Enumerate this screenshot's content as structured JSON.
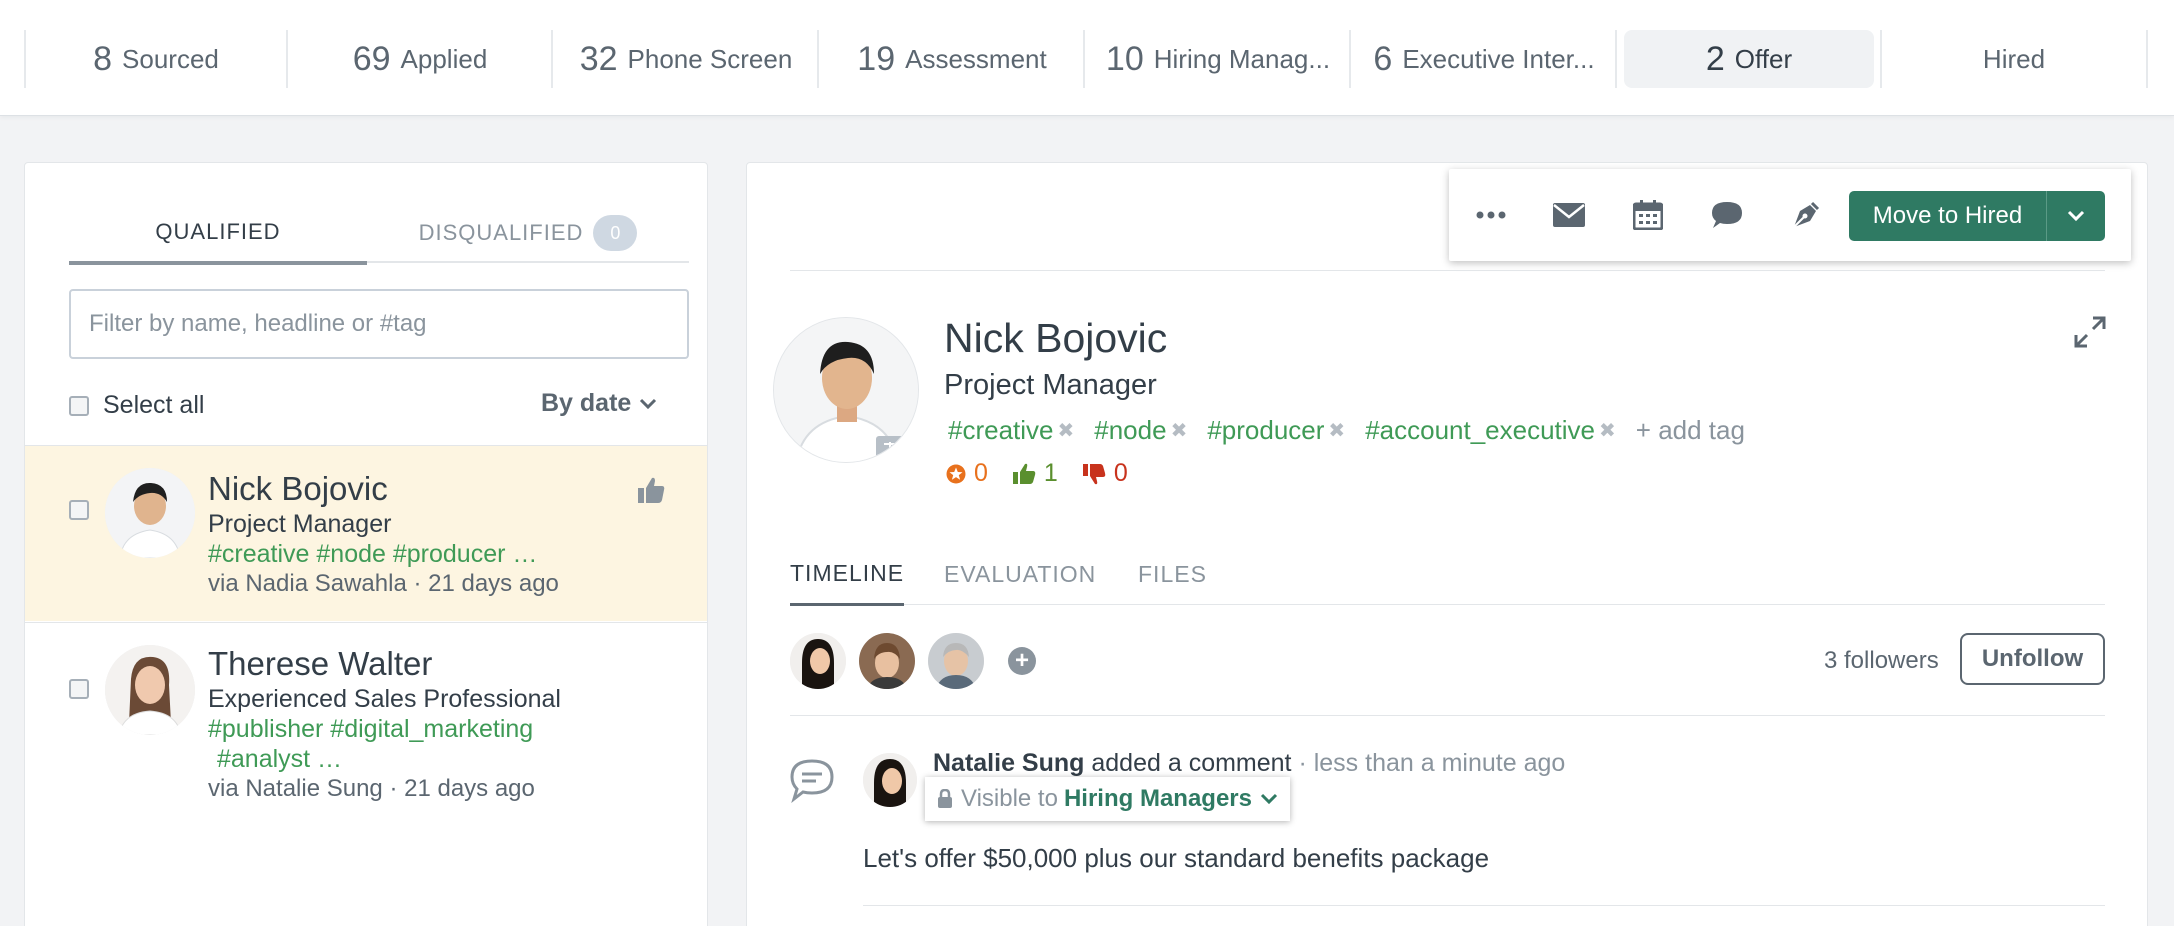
{
  "stages": [
    {
      "count": "8",
      "label": "Sourced"
    },
    {
      "count": "69",
      "label": "Applied"
    },
    {
      "count": "32",
      "label": "Phone Screen"
    },
    {
      "count": "19",
      "label": "Assessment"
    },
    {
      "count": "10",
      "label": "Hiring Manag..."
    },
    {
      "count": "6",
      "label": "Executive Inter..."
    },
    {
      "count": "2",
      "label": "Offer"
    },
    {
      "count": "",
      "label": "Hired"
    }
  ],
  "left": {
    "tab_qualified": "QUALIFIED",
    "tab_disqualified": "DISQUALIFIED",
    "disqualified_count": "0",
    "filter_placeholder": "Filter by name, headline or #tag",
    "select_all": "Select all",
    "sort_label": "By date",
    "candidates": [
      {
        "name": "Nick Bojovic",
        "headline": "Project Manager",
        "tags": "#creative #node #producer …",
        "via": "via Nadia Sawahla · 21 days ago"
      },
      {
        "name": "Therese Walter",
        "headline": "Experienced Sales Professional",
        "tags_line1": "#publisher #digital_marketing",
        "tags_line2": "#analyst …",
        "via": "via Natalie Sung · 21 days ago"
      }
    ]
  },
  "toolbar": {
    "more_icon": "more-icon",
    "email_icon": "email-icon",
    "calendar_icon": "calendar-icon",
    "chat_icon": "chat-icon",
    "sign_icon": "signature-icon",
    "move_label": "Move to Hired"
  },
  "profile": {
    "name": "Nick Bojovic",
    "headline": "Project Manager",
    "tags": [
      "#creative",
      "#node",
      "#producer",
      "#account_executive"
    ],
    "add_tag": "+ add tag",
    "score_star": "0",
    "score_up": "1",
    "score_down": "0"
  },
  "detail_tabs": [
    "TIMELINE",
    "EVALUATION",
    "FILES"
  ],
  "followers": {
    "count_text": "3 followers",
    "unfollow": "Unfollow"
  },
  "comment": {
    "author": "Natalie Sung",
    "action": "added a comment",
    "meta": "· less than a minute ago",
    "visible_to": "Visible to",
    "group": "Hiring Managers",
    "body": "Let's offer $50,000 plus our standard benefits package"
  },
  "colors": {
    "accent_green": "#2f7a63",
    "tag_green": "#3f9a56",
    "selected_row": "#fdf5e1",
    "star_orange": "#e8711d",
    "thumb_green": "#5a8f2e",
    "thumb_red": "#c8331d"
  }
}
